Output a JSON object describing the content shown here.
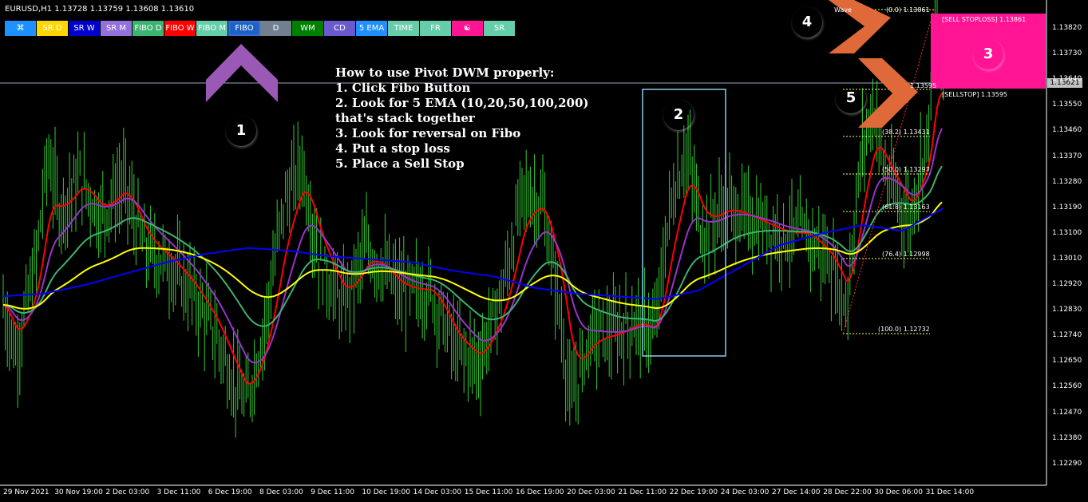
{
  "header": {
    "symbol_info": "EURUSD,H1  1.13728 1.13759 1.13608 1.13610"
  },
  "toolbar": {
    "buttons": [
      {
        "label": "⌘",
        "color": "#1e90ff",
        "width": 40
      },
      {
        "label": "SR D",
        "color": "#ffd700",
        "width": 40
      },
      {
        "label": "SR W",
        "color": "#0000cd",
        "width": 40
      },
      {
        "label": "SR M",
        "color": "#9370db",
        "width": 40
      },
      {
        "label": "FIBO D",
        "color": "#3cb371",
        "width": 40
      },
      {
        "label": "FIBO W",
        "color": "#ff0000",
        "width": 40
      },
      {
        "label": "FIBO M",
        "color": "#66cdaa",
        "width": 40
      },
      {
        "label": "FIBO",
        "color": "#1e62c8",
        "width": 40,
        "selected": true
      },
      {
        "label": "D",
        "color": "#708090",
        "width": 40
      },
      {
        "label": "WM",
        "color": "#008000",
        "width": 40
      },
      {
        "label": "CD",
        "color": "#6a5acd",
        "width": 40
      },
      {
        "label": "5 EMA",
        "color": "#1e90ff",
        "width": 40
      },
      {
        "label": "TIME",
        "color": "#66cdaa",
        "width": 40
      },
      {
        "label": "FR",
        "color": "#66cdaa",
        "width": 40
      },
      {
        "label": "☯",
        "color": "#ff1493",
        "width": 40
      },
      {
        "label": "SR",
        "color": "#66cdaa",
        "width": 40
      }
    ]
  },
  "instructions": {
    "title": "How to use Pivot DWM properly:",
    "steps": [
      "1. Click Fibo Button",
      "2. Look for 5 EMA (10,20,50,100,200)",
      "that's stack together",
      "3. Look for reversal on Fibo",
      "4. Put a stop loss",
      "5. Place a Sell Stop"
    ]
  },
  "badges": [
    {
      "label": "1",
      "color": "#9b59b6"
    },
    {
      "label": "2",
      "color": "#7f9c8a"
    },
    {
      "label": "3",
      "color": "#5b7fc0"
    },
    {
      "label": "4",
      "color": "#6f9a80"
    },
    {
      "label": "5",
      "color": "#e8833a"
    }
  ],
  "price_axis": {
    "labels": [
      "1.13820",
      "1.13730",
      "1.13640",
      "1.13550",
      "1.13460",
      "1.13370",
      "1.13280",
      "1.13190",
      "1.13100",
      "1.13010",
      "1.12920",
      "1.12830",
      "1.12740",
      "1.12650",
      "1.12560",
      "1.12470",
      "1.12380",
      "1.12290"
    ],
    "current_price": "1.13621"
  },
  "time_axis": {
    "labels": [
      "29 Nov 2021",
      "30 Nov 19:00",
      "2 Dec 03:00",
      "3 Dec 11:00",
      "6 Dec 19:00",
      "8 Dec 03:00",
      "9 Dec 11:00",
      "10 Dec 19:00",
      "14 Dec 03:00",
      "15 Dec 11:00",
      "16 Dec 19:00",
      "20 Dec 03:00",
      "21 Dec 11:00",
      "22 Dec 19:00",
      "24 Dec 03:00",
      "27 Dec 14:00",
      "28 Dec 22:00",
      "30 Dec 06:00",
      "31 Dec 14:00"
    ]
  },
  "fibo": {
    "wave_label": "Wave",
    "levels": [
      "(0.0) 1.13861",
      "1.13595",
      "(38.2) 1.13431",
      "(50.0) 1.13297",
      "(61.8) 1.13163",
      "(76.4) 1.12998",
      "(100.0) 1.12732"
    ]
  },
  "orders": {
    "sell_stoploss": "[SELL STOPLOSS] 1.13861",
    "sellstop": "[SELLSTOP] 1.13595"
  },
  "colors": {
    "candles": "#32cd32",
    "ema10": "#ff0000",
    "ema20": "#9932cc",
    "ema50": "#3cb371",
    "ema100": "#ffff00",
    "ema200": "#0000ff",
    "arrow_purple": "#9b59b6",
    "arrow_orange": "#e0693a",
    "box_border": "#87ceeb"
  },
  "chart_data": {
    "type": "line",
    "title": "EURUSD,H1",
    "ylim": [
      1.1222,
      1.1392
    ],
    "series": [
      {
        "name": "EMA 10"
      },
      {
        "name": "EMA 20"
      },
      {
        "name": "EMA 50"
      },
      {
        "name": "EMA 100"
      },
      {
        "name": "EMA 200",
        "values": [
          1.1288,
          1.1289,
          1.1292,
          1.1296,
          1.13,
          1.1303,
          1.1305,
          1.1304,
          1.1302,
          1.1301,
          1.13,
          1.1297,
          1.1295,
          1.1291,
          1.1289,
          1.1288,
          1.1287,
          1.129,
          1.1298,
          1.1306,
          1.131,
          1.1313,
          1.1311,
          1.1319
        ]
      }
    ]
  }
}
